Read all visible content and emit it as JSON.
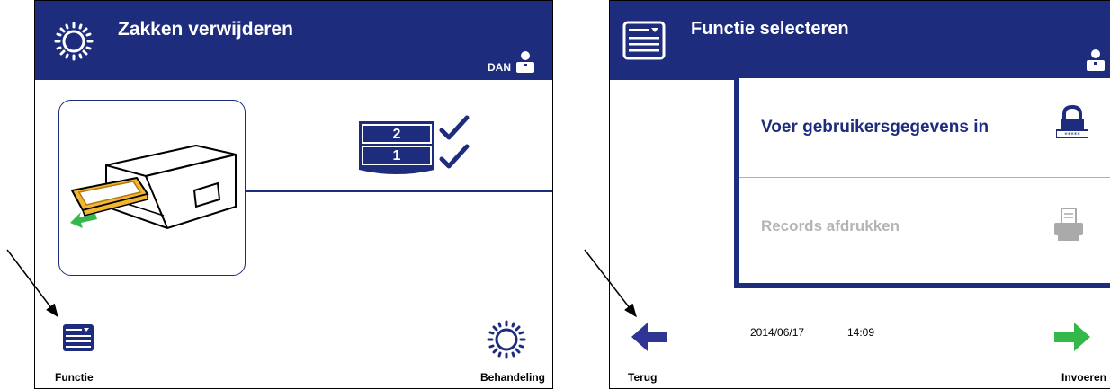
{
  "left_screen": {
    "title": "Zakken verwijderen",
    "user": "DAN",
    "bag_slots": [
      "2",
      "1"
    ],
    "bottom_left_label": "Functie",
    "bottom_right_label": "Behandeling"
  },
  "right_screen": {
    "title": "Functie selecteren",
    "menu_items": [
      {
        "label": "Voer gebruikersgegevens in",
        "enabled": true
      },
      {
        "label": "Records afdrukken",
        "enabled": false
      }
    ],
    "date": "2014/06/17",
    "time": "14:09",
    "back_label": "Terug",
    "enter_label": "Invoeren"
  },
  "colors": {
    "header_blue": "#1d2c7d",
    "accent_green": "#33b849",
    "drawer_orange": "#f2b632",
    "disabled_gray": "#aaaaaa"
  }
}
